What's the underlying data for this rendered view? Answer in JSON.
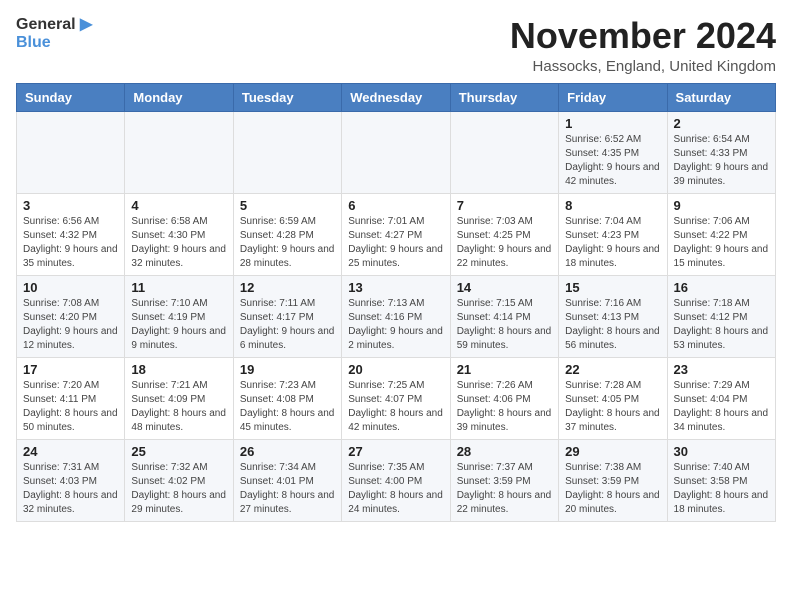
{
  "logo": {
    "text_general": "General",
    "text_blue": "Blue"
  },
  "title": "November 2024",
  "subtitle": "Hassocks, England, United Kingdom",
  "days_of_week": [
    "Sunday",
    "Monday",
    "Tuesday",
    "Wednesday",
    "Thursday",
    "Friday",
    "Saturday"
  ],
  "weeks": [
    [
      {
        "day": "",
        "info": ""
      },
      {
        "day": "",
        "info": ""
      },
      {
        "day": "",
        "info": ""
      },
      {
        "day": "",
        "info": ""
      },
      {
        "day": "",
        "info": ""
      },
      {
        "day": "1",
        "info": "Sunrise: 6:52 AM\nSunset: 4:35 PM\nDaylight: 9 hours and 42 minutes."
      },
      {
        "day": "2",
        "info": "Sunrise: 6:54 AM\nSunset: 4:33 PM\nDaylight: 9 hours and 39 minutes."
      }
    ],
    [
      {
        "day": "3",
        "info": "Sunrise: 6:56 AM\nSunset: 4:32 PM\nDaylight: 9 hours and 35 minutes."
      },
      {
        "day": "4",
        "info": "Sunrise: 6:58 AM\nSunset: 4:30 PM\nDaylight: 9 hours and 32 minutes."
      },
      {
        "day": "5",
        "info": "Sunrise: 6:59 AM\nSunset: 4:28 PM\nDaylight: 9 hours and 28 minutes."
      },
      {
        "day": "6",
        "info": "Sunrise: 7:01 AM\nSunset: 4:27 PM\nDaylight: 9 hours and 25 minutes."
      },
      {
        "day": "7",
        "info": "Sunrise: 7:03 AM\nSunset: 4:25 PM\nDaylight: 9 hours and 22 minutes."
      },
      {
        "day": "8",
        "info": "Sunrise: 7:04 AM\nSunset: 4:23 PM\nDaylight: 9 hours and 18 minutes."
      },
      {
        "day": "9",
        "info": "Sunrise: 7:06 AM\nSunset: 4:22 PM\nDaylight: 9 hours and 15 minutes."
      }
    ],
    [
      {
        "day": "10",
        "info": "Sunrise: 7:08 AM\nSunset: 4:20 PM\nDaylight: 9 hours and 12 minutes."
      },
      {
        "day": "11",
        "info": "Sunrise: 7:10 AM\nSunset: 4:19 PM\nDaylight: 9 hours and 9 minutes."
      },
      {
        "day": "12",
        "info": "Sunrise: 7:11 AM\nSunset: 4:17 PM\nDaylight: 9 hours and 6 minutes."
      },
      {
        "day": "13",
        "info": "Sunrise: 7:13 AM\nSunset: 4:16 PM\nDaylight: 9 hours and 2 minutes."
      },
      {
        "day": "14",
        "info": "Sunrise: 7:15 AM\nSunset: 4:14 PM\nDaylight: 8 hours and 59 minutes."
      },
      {
        "day": "15",
        "info": "Sunrise: 7:16 AM\nSunset: 4:13 PM\nDaylight: 8 hours and 56 minutes."
      },
      {
        "day": "16",
        "info": "Sunrise: 7:18 AM\nSunset: 4:12 PM\nDaylight: 8 hours and 53 minutes."
      }
    ],
    [
      {
        "day": "17",
        "info": "Sunrise: 7:20 AM\nSunset: 4:11 PM\nDaylight: 8 hours and 50 minutes."
      },
      {
        "day": "18",
        "info": "Sunrise: 7:21 AM\nSunset: 4:09 PM\nDaylight: 8 hours and 48 minutes."
      },
      {
        "day": "19",
        "info": "Sunrise: 7:23 AM\nSunset: 4:08 PM\nDaylight: 8 hours and 45 minutes."
      },
      {
        "day": "20",
        "info": "Sunrise: 7:25 AM\nSunset: 4:07 PM\nDaylight: 8 hours and 42 minutes."
      },
      {
        "day": "21",
        "info": "Sunrise: 7:26 AM\nSunset: 4:06 PM\nDaylight: 8 hours and 39 minutes."
      },
      {
        "day": "22",
        "info": "Sunrise: 7:28 AM\nSunset: 4:05 PM\nDaylight: 8 hours and 37 minutes."
      },
      {
        "day": "23",
        "info": "Sunrise: 7:29 AM\nSunset: 4:04 PM\nDaylight: 8 hours and 34 minutes."
      }
    ],
    [
      {
        "day": "24",
        "info": "Sunrise: 7:31 AM\nSunset: 4:03 PM\nDaylight: 8 hours and 32 minutes."
      },
      {
        "day": "25",
        "info": "Sunrise: 7:32 AM\nSunset: 4:02 PM\nDaylight: 8 hours and 29 minutes."
      },
      {
        "day": "26",
        "info": "Sunrise: 7:34 AM\nSunset: 4:01 PM\nDaylight: 8 hours and 27 minutes."
      },
      {
        "day": "27",
        "info": "Sunrise: 7:35 AM\nSunset: 4:00 PM\nDaylight: 8 hours and 24 minutes."
      },
      {
        "day": "28",
        "info": "Sunrise: 7:37 AM\nSunset: 3:59 PM\nDaylight: 8 hours and 22 minutes."
      },
      {
        "day": "29",
        "info": "Sunrise: 7:38 AM\nSunset: 3:59 PM\nDaylight: 8 hours and 20 minutes."
      },
      {
        "day": "30",
        "info": "Sunrise: 7:40 AM\nSunset: 3:58 PM\nDaylight: 8 hours and 18 minutes."
      }
    ]
  ]
}
